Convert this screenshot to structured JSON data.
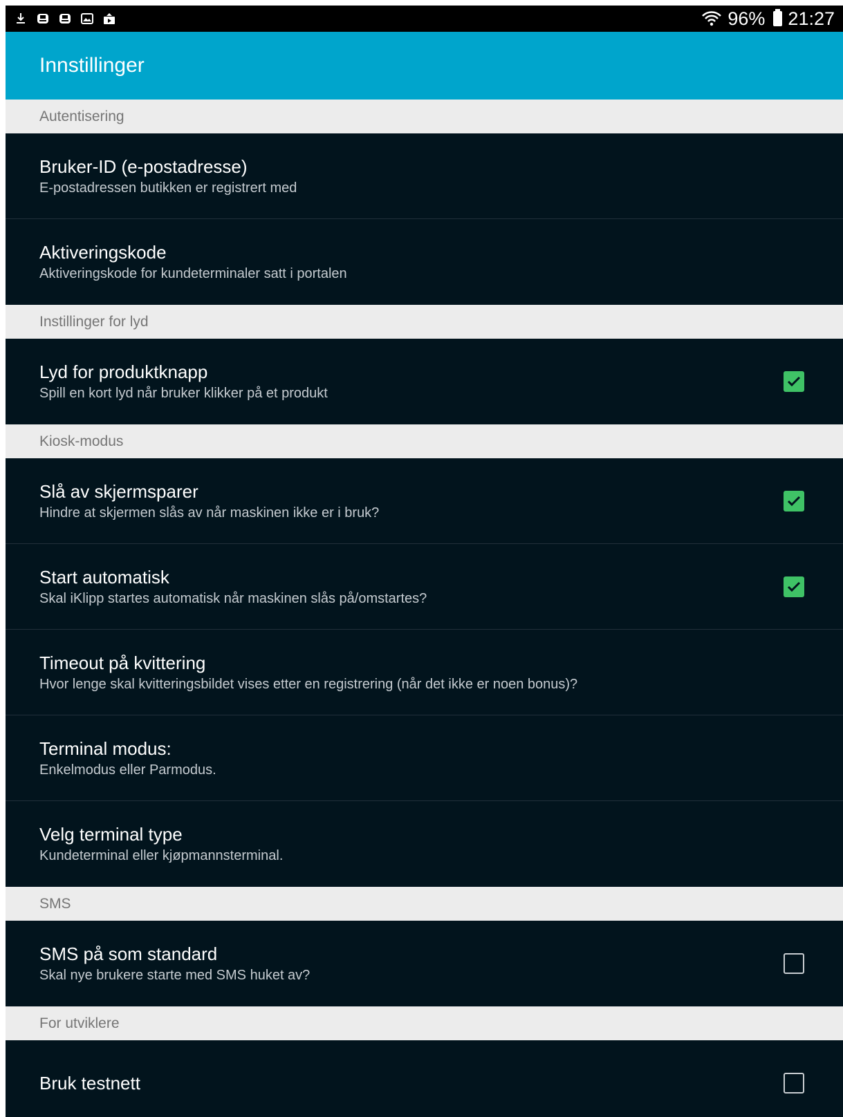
{
  "status_bar": {
    "icons_left": [
      "download-icon",
      "storage-icon",
      "storage-icon",
      "gallery-icon",
      "upload-icon"
    ],
    "wifi_icon": "wifi-icon",
    "battery_percent": "96%",
    "time": "21:27"
  },
  "action_bar": {
    "title": "Innstillinger"
  },
  "sections": [
    {
      "header": "Autentisering",
      "items": [
        {
          "title": "Bruker-ID (e-postadresse)",
          "summary": "E-postadressen butikken er registrert med",
          "checkbox": null
        },
        {
          "title": "Aktiveringskode",
          "summary": "Aktiveringskode for kundeterminaler satt i portalen",
          "checkbox": null
        }
      ]
    },
    {
      "header": "Instillinger for lyd",
      "items": [
        {
          "title": "Lyd for produktknapp",
          "summary": "Spill en kort lyd når bruker klikker på et produkt",
          "checkbox": true
        }
      ]
    },
    {
      "header": "Kiosk-modus",
      "items": [
        {
          "title": "Slå av skjermsparer",
          "summary": "Hindre at skjermen slås av når maskinen ikke er i bruk?",
          "checkbox": true
        },
        {
          "title": "Start automatisk",
          "summary": "Skal iKlipp startes automatisk når maskinen slås på/omstartes?",
          "checkbox": true
        },
        {
          "title": "Timeout på kvittering",
          "summary": "Hvor lenge skal kvitteringsbildet vises etter en registrering (når det ikke er noen bonus)?",
          "checkbox": null
        },
        {
          "title": "Terminal modus:",
          "summary": "Enkelmodus eller Parmodus.",
          "checkbox": null
        },
        {
          "title": "Velg terminal type",
          "summary": "Kundeterminal eller kjøpmannsterminal.",
          "checkbox": null
        }
      ]
    },
    {
      "header": "SMS",
      "items": [
        {
          "title": "SMS på som standard",
          "summary": "Skal nye brukere starte med SMS huket av?",
          "checkbox": false
        }
      ]
    },
    {
      "header": "For utviklere",
      "items": [
        {
          "title": "Bruk testnett",
          "summary": "",
          "checkbox": false
        }
      ]
    }
  ],
  "colors": {
    "action_bar": "#00a5cc",
    "list_background": "#02141d",
    "category_background": "#ececec",
    "checkbox_checked": "#3fc266"
  }
}
